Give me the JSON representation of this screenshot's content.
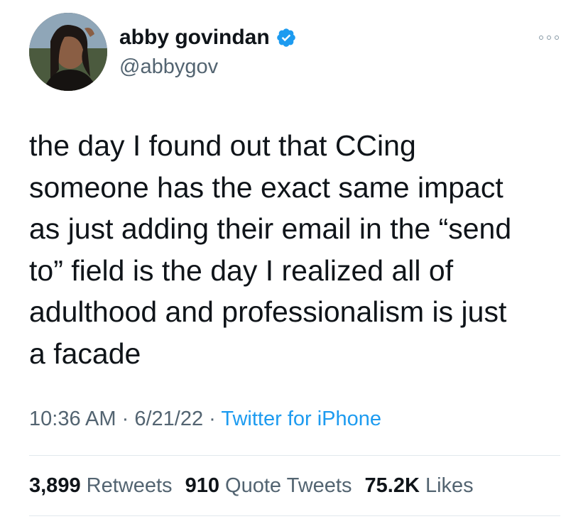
{
  "tweet": {
    "author": {
      "display_name": "abby govindan",
      "handle": "@abbygov",
      "verified": true
    },
    "text": "the day I found out that CCing\nsomeone has the exact same impact\nas just adding their email in the “send\nto” field is the day I realized all of\nadulthood and professionalism is just\na facade",
    "time": "10:36 AM",
    "date": "6/21/22",
    "source": "Twitter for iPhone",
    "separator": "·",
    "stats": {
      "retweets_count": "3,899",
      "retweets_label": "Retweets",
      "quote_count": "910",
      "quote_label": "Quote Tweets",
      "likes_count": "75.2K",
      "likes_label": "Likes"
    }
  },
  "icons": {
    "verified": "verified-badge-icon",
    "more": "more-options-icon"
  },
  "colors": {
    "verified_blue": "#1d9bf0",
    "secondary_text": "#536471",
    "link": "#1d9bf0"
  }
}
